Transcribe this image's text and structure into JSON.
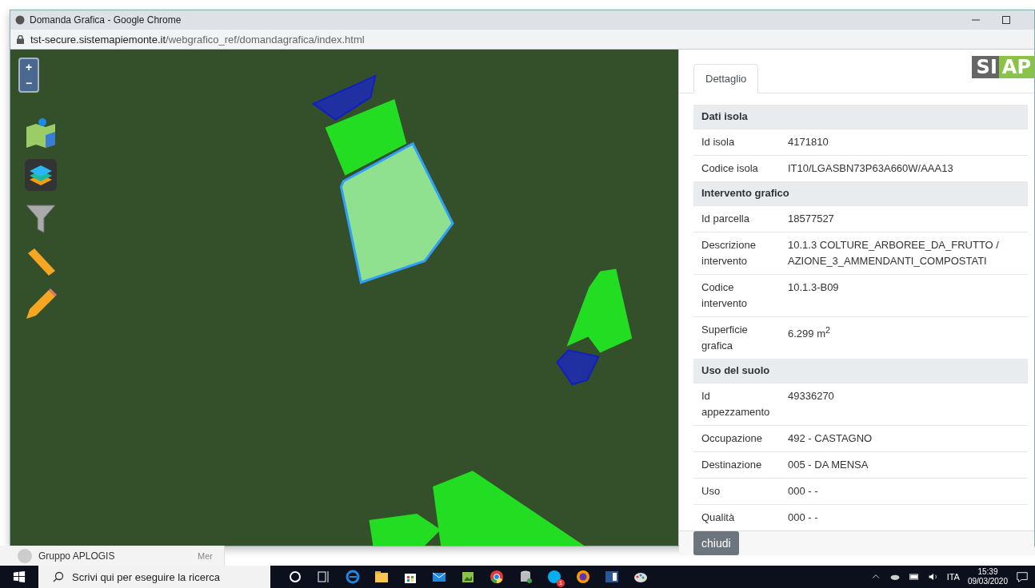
{
  "window": {
    "title": "Domanda Grafica - Google Chrome",
    "url_host": "tst-secure.sistemapiemonte.it",
    "url_path": "/webgrafico_ref/domandagrafica/index.html"
  },
  "map": {
    "zoom_in": "+",
    "zoom_out": "−"
  },
  "panel": {
    "tabs": [
      {
        "label": "Dettaglio",
        "selected": true
      }
    ],
    "logo": {
      "part1": "SI",
      "part2": "AP"
    },
    "rows": [
      {
        "kind": "header",
        "label": "Dati isola"
      },
      {
        "kind": "row",
        "label": "Id isola",
        "value": "4171810"
      },
      {
        "kind": "row",
        "label": "Codice isola",
        "value": "IT10/LGASBN73P63A660W/AAA13"
      },
      {
        "kind": "header",
        "label": "Intervento grafico"
      },
      {
        "kind": "row",
        "label": "Id parcella",
        "value": "18577527"
      },
      {
        "kind": "row",
        "label": "Descrizione intervento",
        "value": "10.1.3 COLTURE_ARBOREE_DA_FRUTTO / AZIONE_3_AMMENDANTI_COMPOSTATI"
      },
      {
        "kind": "row",
        "label": "Codice intervento",
        "value": "10.1.3-B09"
      },
      {
        "kind": "row",
        "label": "Superficie grafica",
        "value": "6.299 m$^{2}$"
      },
      {
        "kind": "header",
        "label": "Uso del suolo"
      },
      {
        "kind": "row",
        "label": "Id appezzamento",
        "value": "49336270"
      },
      {
        "kind": "row",
        "label": "Occupazione",
        "value": "492 - CASTAGNO"
      },
      {
        "kind": "row",
        "label": "Destinazione",
        "value": "005 - DA MENSA"
      },
      {
        "kind": "row",
        "label": "Uso",
        "value": "000 - -"
      },
      {
        "kind": "row",
        "label": "Qualità",
        "value": "000 - -"
      }
    ],
    "close_button": "chiudi"
  },
  "background": {
    "sender": "Gruppo APLOGIS",
    "day": "Mer"
  },
  "taskbar": {
    "search_placeholder": "Scrivi qui per eseguire la ricerca",
    "skype_badge": "1",
    "language": "ITA",
    "time": "15:39",
    "date": "09/03/2020"
  }
}
